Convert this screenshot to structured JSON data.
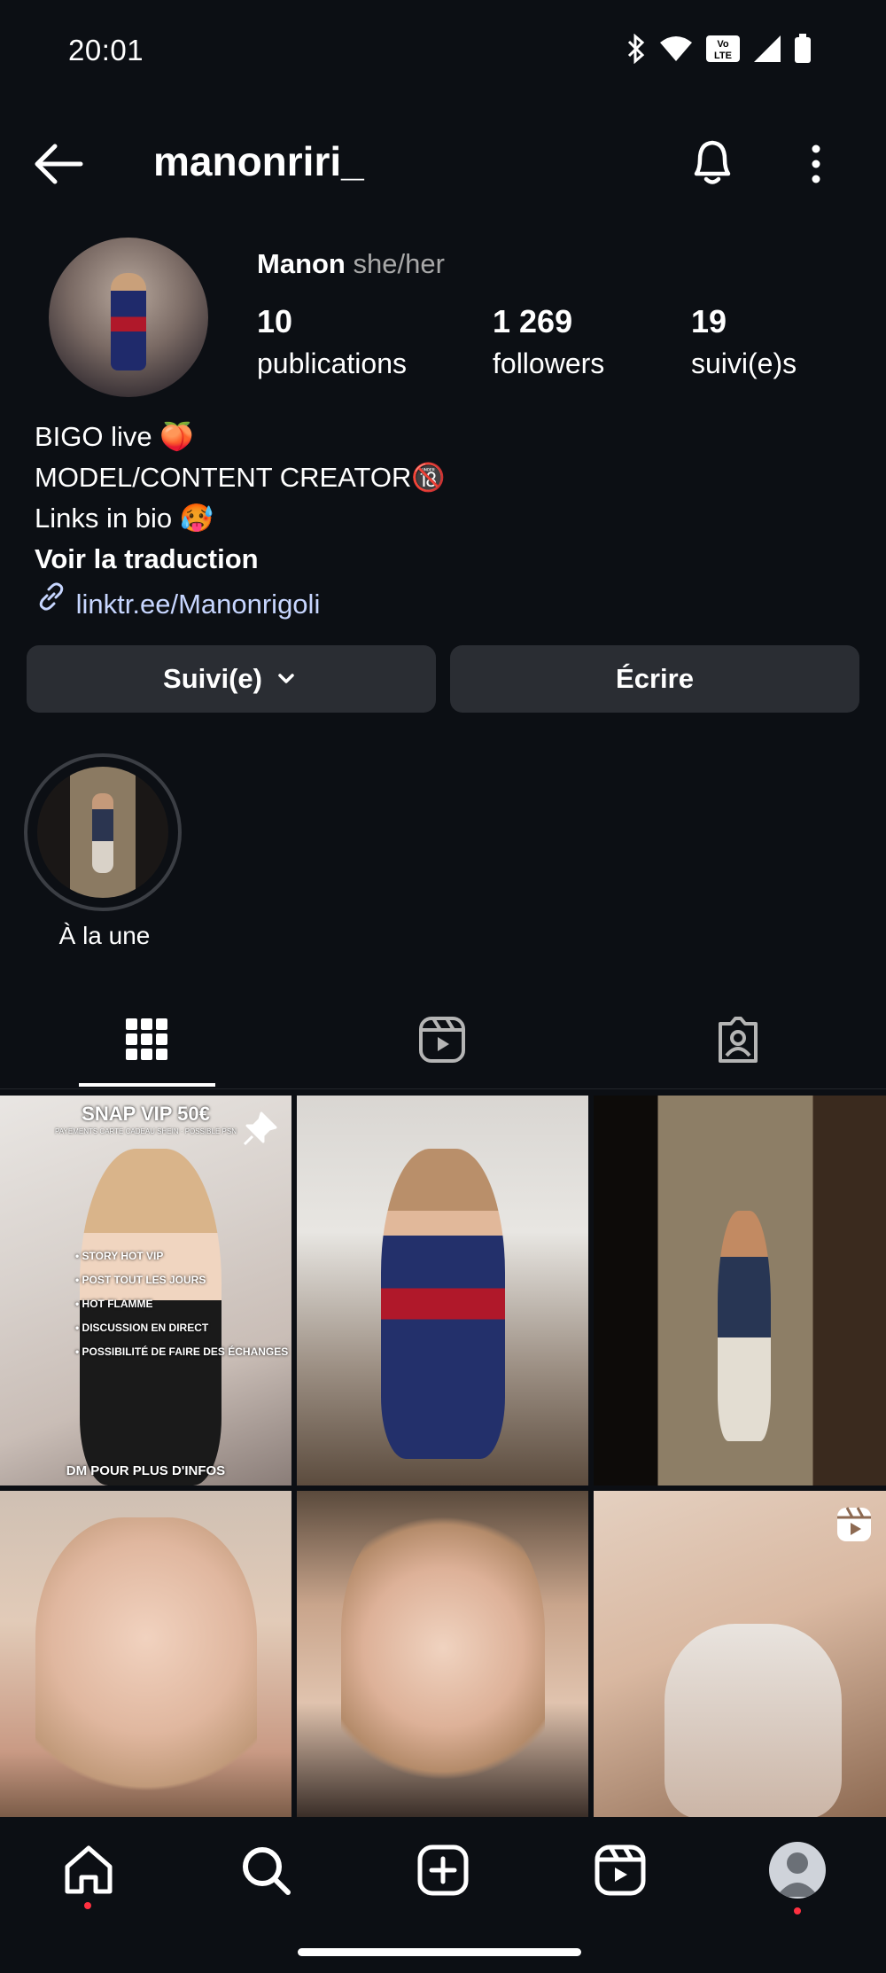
{
  "status_bar": {
    "time": "20:01",
    "volte": "Vo LTE"
  },
  "header": {
    "username": "manonriri_"
  },
  "profile": {
    "name": "Manon",
    "pronouns": "she/her",
    "stats": [
      {
        "value": "10",
        "label": "publications"
      },
      {
        "value": "1 269",
        "label": "followers"
      },
      {
        "value": "19",
        "label": "suivi(e)s"
      }
    ],
    "bio_lines": [
      "BIGO live 🍑",
      "MODEL/CONTENT CREATOR🔞",
      "Links in bio 🥵"
    ],
    "translate": "Voir la traduction",
    "link": "linktr.ee/Manonrigoli"
  },
  "actions": {
    "follow_label": "Suivi(e)",
    "message_label": "Écrire"
  },
  "highlights": [
    {
      "label": "À la une"
    }
  ],
  "posts": {
    "first": {
      "headline": "SNAP VIP 50€",
      "subline": "PAYEMENTS CARTE CADEAU SHEIN · POSSIBLE PSN",
      "items": [
        "• STORY HOT VIP",
        "• POST TOUT LES JOURS",
        "• HOT FLAMME",
        "• DISCUSSION EN DIRECT",
        "• POSSIBILITÉ DE FAIRE DES ÉCHANGES"
      ],
      "footer": "DM POUR PLUS D'INFOS"
    }
  },
  "icons": {
    "back": "back-arrow-icon",
    "bell": "bell-icon",
    "more": "more-icon",
    "link": "link-icon",
    "grid": "grid-icon",
    "reels": "reels-icon",
    "tagged": "tagged-icon",
    "home": "home-icon",
    "search": "search-icon",
    "create": "create-icon",
    "profile": "profile-icon"
  },
  "colors": {
    "background": "#0c0f14",
    "button": "#2a2d33",
    "link": "#c7d6ff",
    "notification_dot": "#ff3040"
  }
}
